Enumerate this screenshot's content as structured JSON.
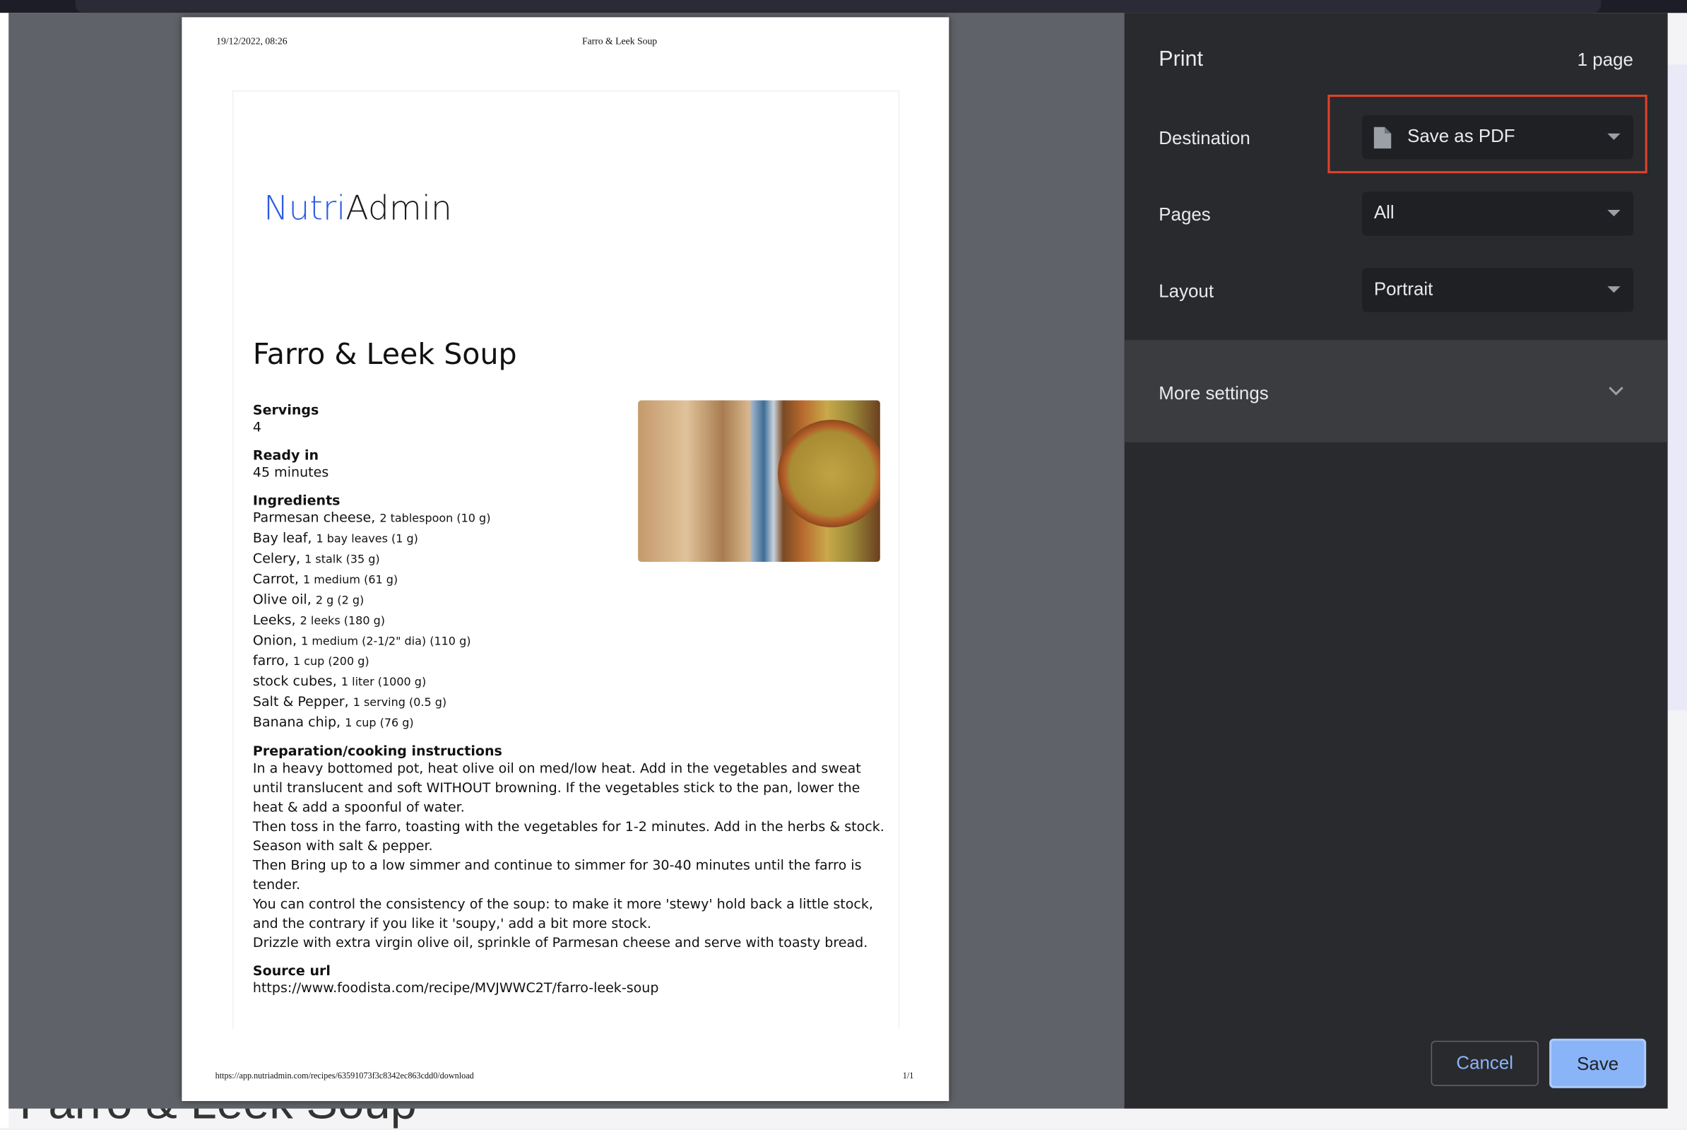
{
  "dialog": {
    "title": "Print",
    "page_count": "1 page",
    "destination": {
      "label": "Destination",
      "value": "Save as PDF",
      "icon": "file-icon"
    },
    "pages": {
      "label": "Pages",
      "value": "All"
    },
    "layout": {
      "label": "Layout",
      "value": "Portrait"
    },
    "more_settings": "More settings",
    "cancel": "Cancel",
    "save": "Save",
    "highlight_color": "#e0412c",
    "accent": "#8ab4f8"
  },
  "preview": {
    "header_date": "19/12/2022, 08:26",
    "header_title": "Farro & Leek Soup",
    "footer_url": "https://app.nutriadmin.com/recipes/63591073f3c8342ec863cdd0/download",
    "footer_page": "1/1",
    "logo": {
      "part1": "Nutri",
      "part2": "Admin"
    },
    "recipe_title": "Farro & Leek Soup",
    "servings_label": "Servings",
    "servings": "4",
    "ready_label": "Ready in",
    "ready": "45 minutes",
    "ingredients_label": "Ingredients",
    "ingredients": [
      {
        "name": "Parmesan cheese,",
        "qty": "2 tablespoon (10 g)"
      },
      {
        "name": "Bay leaf,",
        "qty": "1 bay leaves (1 g)"
      },
      {
        "name": "Celery,",
        "qty": "1 stalk (35 g)"
      },
      {
        "name": "Carrot,",
        "qty": "1 medium (61 g)"
      },
      {
        "name": "Olive oil,",
        "qty": "2 g (2 g)"
      },
      {
        "name": "Leeks,",
        "qty": "2 leeks (180 g)"
      },
      {
        "name": "Onion,",
        "qty": "1 medium (2-1/2\" dia) (110 g)"
      },
      {
        "name": "farro,",
        "qty": "1 cup (200 g)"
      },
      {
        "name": "stock cubes,",
        "qty": "1 liter (1000 g)"
      },
      {
        "name": "Salt & Pepper,",
        "qty": "1 serving (0.5 g)"
      },
      {
        "name": "Banana chip,",
        "qty": "1 cup (76 g)"
      }
    ],
    "instructions_label": "Preparation/cooking instructions",
    "instructions": [
      "In a heavy bottomed pot, heat olive oil on med/low heat. Add in the vegetables and sweat",
      "until translucent and soft WITHOUT browning. If the vegetables stick to the pan, lower the",
      "heat & add a spoonful of water.",
      "Then toss in the farro, toasting with the vegetables for 1-2 minutes. Add in the herbs & stock.",
      "Season with salt & pepper.",
      "Then Bring up to a low simmer and continue to simmer for 30-40 minutes until the farro is",
      "tender.",
      "You can control the consistency of the soup: to make it more 'stewy' hold back a little stock,",
      "and the contrary if you like it 'soupy,' add a bit more stock.",
      "Drizzle with extra virgin olive oil, sprinkle of Parmesan cheese and serve with toasty bread."
    ],
    "source_label": "Source url",
    "source_url": "https://www.foodista.com/recipe/MVJWWC2T/farro-leek-soup"
  },
  "background_page_title": "Farro & Leek Soup"
}
